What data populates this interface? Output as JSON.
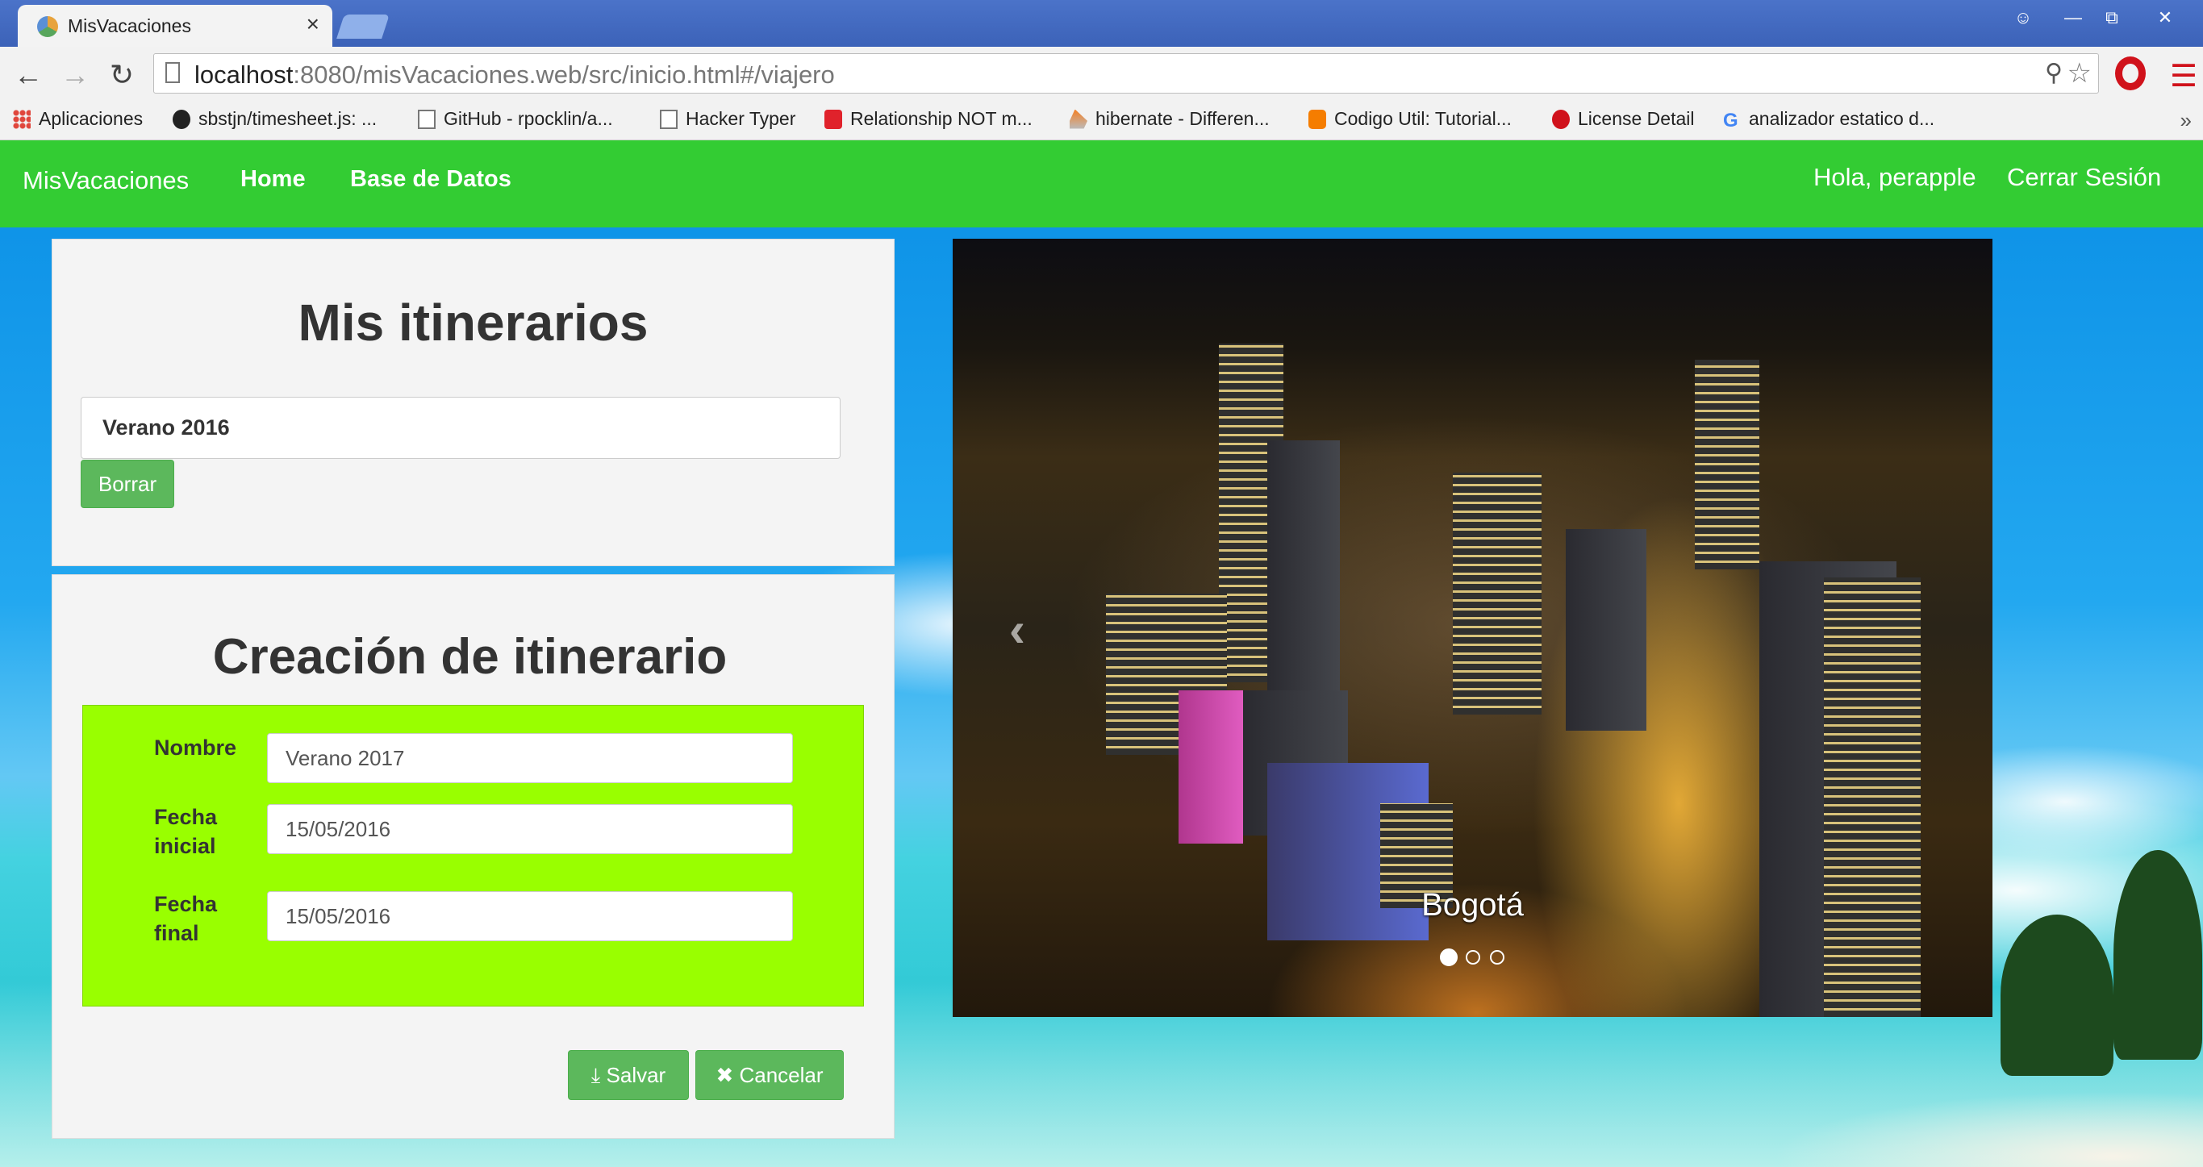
{
  "browser": {
    "tab_title": "MisVacaciones",
    "tab_close": "×",
    "url_host": "localhost",
    "url_rest": ":8080/misVacaciones.web/src/inicio.html#/viajero",
    "bookmarks": [
      {
        "label": "Aplicaciones",
        "icon": "apps-icon"
      },
      {
        "label": "sbstjn/timesheet.js: ...",
        "icon": "github-icon"
      },
      {
        "label": "GitHub - rpocklin/a...",
        "icon": "page-icon"
      },
      {
        "label": "Hacker Typer",
        "icon": "page-icon"
      },
      {
        "label": "Relationship NOT m...",
        "icon": "relationship-icon"
      },
      {
        "label": "hibernate - Differen...",
        "icon": "stackoverflow-icon"
      },
      {
        "label": "Codigo Util: Tutorial...",
        "icon": "blogger-icon"
      },
      {
        "label": "License Detail",
        "icon": "license-icon"
      },
      {
        "label": "analizador estatico d...",
        "icon": "google-icon"
      }
    ],
    "more": "»"
  },
  "navbar": {
    "brand": "MisVacaciones",
    "links": [
      "Home",
      "Base de Datos"
    ],
    "greeting": "Hola, perapple",
    "logout": "Cerrar Sesión",
    "color": "#33cc33"
  },
  "itinerarios": {
    "title": "Mis itinerarios",
    "item_value": "Verano 2016",
    "delete_label": "Borrar"
  },
  "creacion": {
    "title": "Creación de itinerario",
    "fields": [
      {
        "label_line1": "Nombre",
        "label_line2": "",
        "value": "Verano 2017"
      },
      {
        "label_line1": "Fecha",
        "label_line2": "inicial",
        "value": "15/05/2016"
      },
      {
        "label_line1": "Fecha",
        "label_line2": "final",
        "value": "15/05/2016"
      }
    ],
    "save_label": "Salvar",
    "cancel_label": "Cancelar",
    "form_color": "#99ff00"
  },
  "carousel": {
    "caption": "Bogotá",
    "prev": "‹",
    "slides": 3,
    "active": 0
  }
}
